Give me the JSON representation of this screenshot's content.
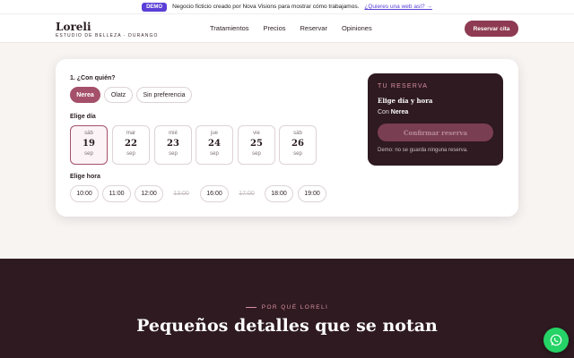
{
  "demo": {
    "badge": "DEMO",
    "text": "Negocio ficticio creado por Nova Visions para mostrar cómo trabajamos.",
    "link": "¿Quieres una web así? →"
  },
  "header": {
    "logo": "Loreli",
    "tagline": "ESTUDIO DE BELLEZA · DURANGO",
    "nav": [
      "Tratamientos",
      "Precios",
      "Reservar",
      "Opiniones"
    ],
    "cta": "Reservar cita"
  },
  "booking": {
    "who_label": "1. ¿Con quién?",
    "who_options": [
      "Nerea",
      "Olatz",
      "Sin preferencia"
    ],
    "who_selected": "Nerea",
    "day_label": "Elige día",
    "days": [
      {
        "name": "sáb",
        "num": "19",
        "month": "sep",
        "selected": true
      },
      {
        "name": "mar",
        "num": "22",
        "month": "sep"
      },
      {
        "name": "mié",
        "num": "23",
        "month": "sep"
      },
      {
        "name": "jue",
        "num": "24",
        "month": "sep"
      },
      {
        "name": "vie",
        "num": "25",
        "month": "sep"
      },
      {
        "name": "sáb",
        "num": "26",
        "month": "sep"
      }
    ],
    "time_label": "Elige hora",
    "times": [
      {
        "label": "10:00"
      },
      {
        "label": "11:00"
      },
      {
        "label": "12:00"
      },
      {
        "label": "13:00",
        "disabled": true
      },
      {
        "label": "16:00"
      },
      {
        "label": "17:00",
        "disabled": true
      },
      {
        "label": "18:00"
      },
      {
        "label": "19:00"
      }
    ]
  },
  "summary": {
    "title": "TU RESERVA",
    "line1": "Elige día y hora",
    "with_prefix": "Con",
    "with_name": "Nerea",
    "confirm": "Confirmar reserva",
    "note": "Demo: no se guarda ninguna reserva."
  },
  "why": {
    "eyebrow": "POR QUÉ LORELI",
    "title": "Pequeños detalles que se notan"
  },
  "colors": {
    "accent": "#a5506a",
    "dark": "#2e1a20",
    "whatsapp": "#25d366",
    "demo_badge": "#5b3fd6"
  },
  "icons": {
    "floating": "whatsapp-icon"
  }
}
